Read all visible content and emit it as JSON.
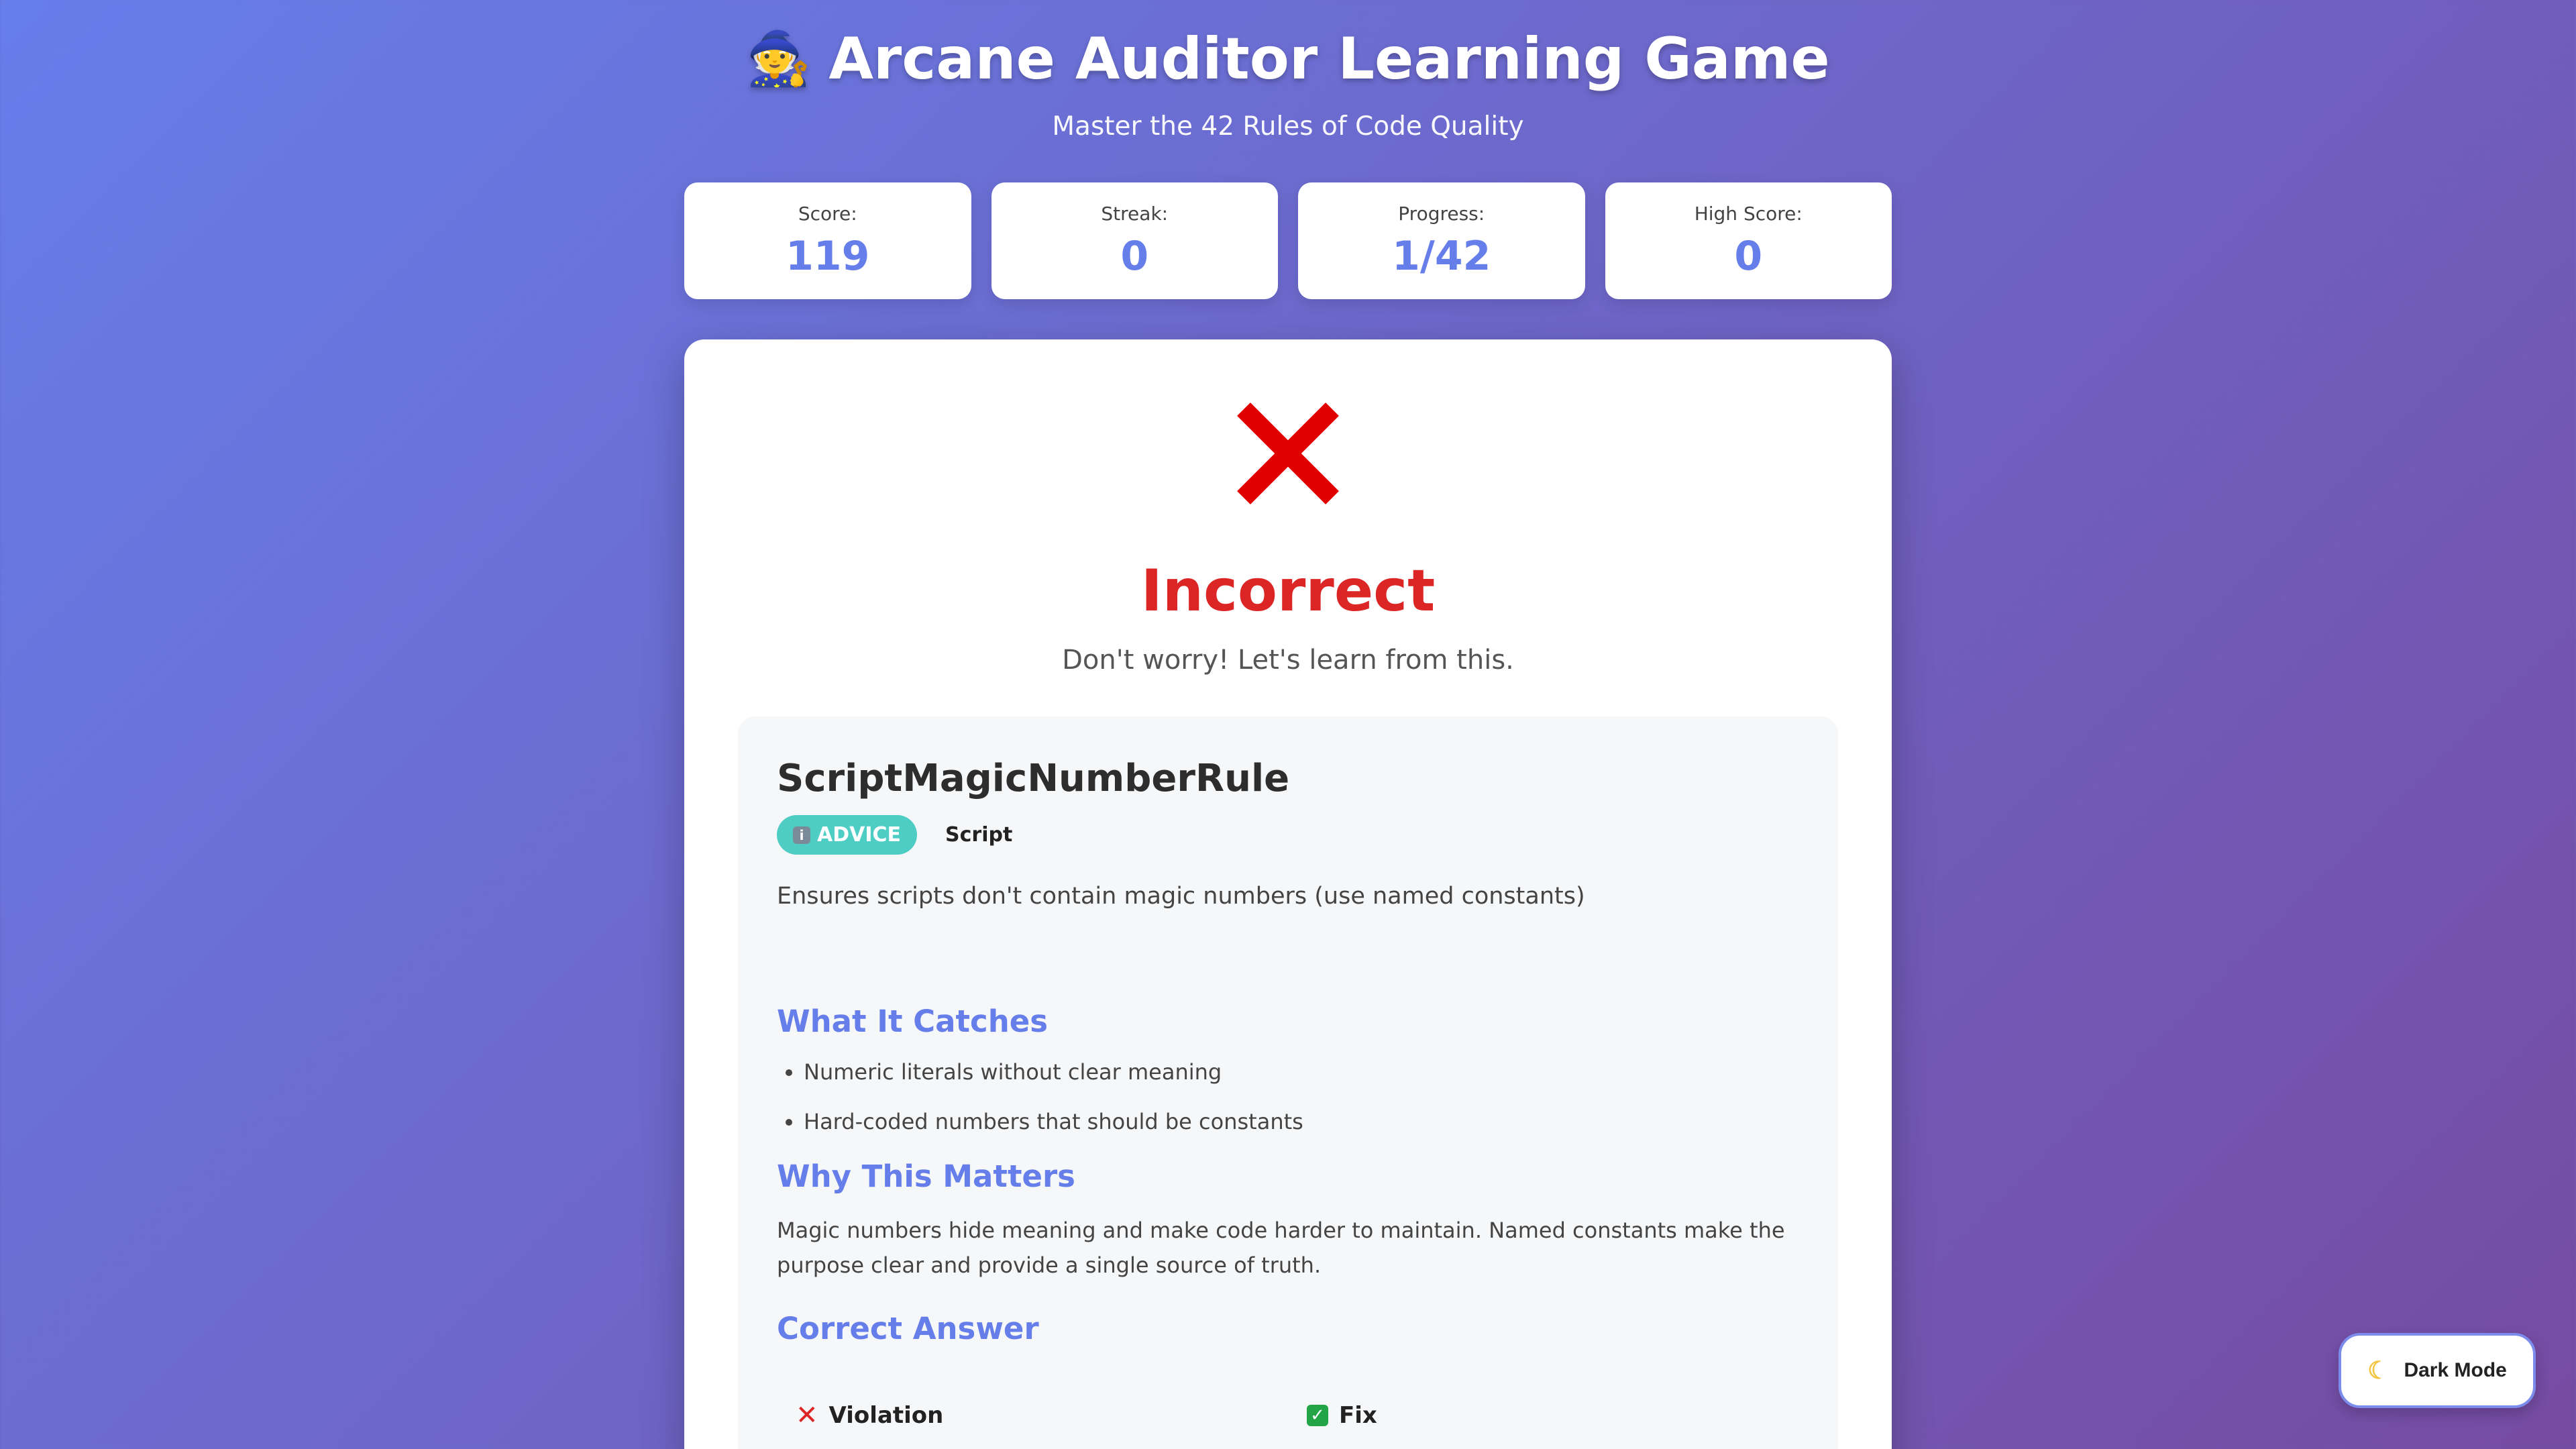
{
  "header": {
    "icon": "wizard-icon",
    "title": "Arcane Auditor Learning Game",
    "subtitle": "Master the 42 Rules of Code Quality"
  },
  "stats": [
    {
      "label": "Score:",
      "value": "119"
    },
    {
      "label": "Streak:",
      "value": "0"
    },
    {
      "label": "Progress:",
      "value": "1/42"
    },
    {
      "label": "High Score:",
      "value": "0"
    }
  ],
  "result": {
    "icon": "cross-mark-icon",
    "title": "Incorrect",
    "message": "Don't worry! Let's learn from this."
  },
  "rule": {
    "name": "ScriptMagicNumberRule",
    "severity_icon": "info-icon",
    "severity": "ADVICE",
    "category": "Script",
    "description": "Ensures scripts don't contain magic numbers (use named constants)",
    "catches_title": "What It Catches",
    "catches": [
      "Numeric literals without clear meaning",
      "Hard-coded numbers that should be constants"
    ],
    "why_title": "Why This Matters",
    "why_text": "Magic numbers hide meaning and make code harder to maintain. Named constants make the purpose clear and provide a single source of truth.",
    "answer_title": "Correct Answer",
    "violation_label": "Violation",
    "fix_label": "Fix"
  },
  "dark_mode": {
    "icon": "moon-icon",
    "label": "Dark Mode"
  },
  "colors": {
    "accent": "#667eea",
    "incorrect": "#dc2626",
    "advice_badge": "#4ecdc4",
    "fix_check": "#22a447"
  }
}
